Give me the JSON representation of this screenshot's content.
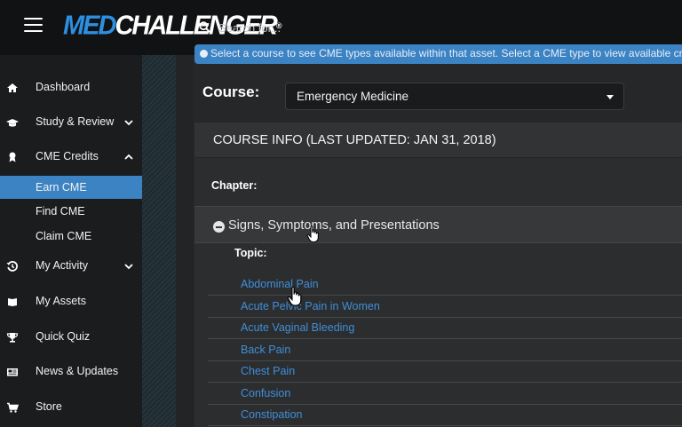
{
  "header": {
    "logo_med": "MED",
    "logo_challenger": "CHALLENGER",
    "logo_reg": "®",
    "search_placeholder": "Search for..."
  },
  "sidebar": {
    "items": [
      {
        "label": "Dashboard",
        "icon": "home-icon"
      },
      {
        "label": "Study & Review",
        "icon": "graduation-cap-icon"
      },
      {
        "label": "CME Credits",
        "icon": "certificate-icon"
      },
      {
        "label": "My Activity",
        "icon": "history-icon"
      },
      {
        "label": "My Assets",
        "icon": "book-icon"
      },
      {
        "label": "Quick Quiz",
        "icon": "trophy-icon"
      },
      {
        "label": "News & Updates",
        "icon": "newspaper-icon"
      },
      {
        "label": "Store",
        "icon": "cart-icon"
      }
    ],
    "cme_sub": [
      {
        "label": "Earn CME",
        "active": true
      },
      {
        "label": "Find CME",
        "active": false
      },
      {
        "label": "Claim CME",
        "active": false
      }
    ]
  },
  "banner": {
    "text": "Select a course to see CME types available within that asset. Select a CME type to view available credit"
  },
  "course": {
    "label": "Course:",
    "selected": "Emergency Medicine"
  },
  "panel": {
    "title": "COURSE INFO (LAST UPDATED: JAN 31, 2018)",
    "chapter_label": "Chapter:",
    "chapter": "Signs, Symptoms, and Presentations",
    "topic_label": "Topic:",
    "topics": [
      "Abdominal Pain",
      "Acute Pelvic Pain in Women",
      "Acute Vaginal Bleeding",
      "Back Pain",
      "Chest Pain",
      "Confusion",
      "Constipation"
    ]
  },
  "colors": {
    "accent": "#3c83c4",
    "link": "#3f8fd8",
    "logo_blue": "#2d8fe0"
  }
}
